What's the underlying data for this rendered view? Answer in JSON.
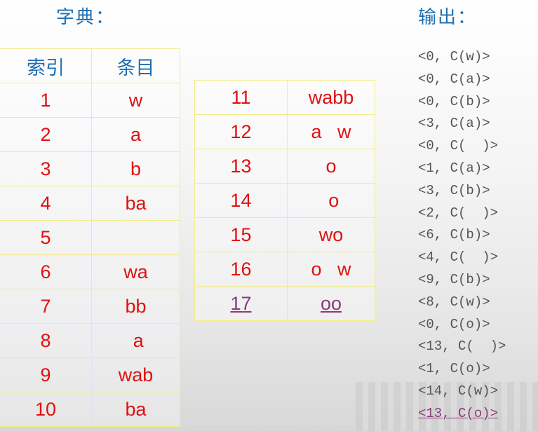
{
  "headings": {
    "dictionary": "字典：",
    "output": "输出："
  },
  "table_headers": {
    "index": "索引",
    "entry": "条目"
  },
  "table1": [
    {
      "index": "1",
      "entry": "w"
    },
    {
      "index": "2",
      "entry": "a"
    },
    {
      "index": "3",
      "entry": "b"
    },
    {
      "index": "4",
      "entry": "ba"
    },
    {
      "index": "5",
      "entry": ""
    },
    {
      "index": "6",
      "entry": "wa"
    },
    {
      "index": "7",
      "entry": "bb"
    },
    {
      "index": "8",
      "entry": " a"
    },
    {
      "index": "9",
      "entry": "wab"
    },
    {
      "index": "10",
      "entry": "ba"
    }
  ],
  "table2": [
    {
      "index": "11",
      "entry": "wabb"
    },
    {
      "index": "12",
      "entry": "a   w"
    },
    {
      "index": "13",
      "entry": "o"
    },
    {
      "index": "14",
      "entry": " o"
    },
    {
      "index": "15",
      "entry": "wo"
    },
    {
      "index": "16",
      "entry": "o   w"
    },
    {
      "index": "17",
      "entry": "oo"
    }
  ],
  "output": [
    "<0, C(w)>",
    "<0, C(a)>",
    "<0, C(b)>",
    "<3, C(a)>",
    "<0, C(  )>",
    "<1, C(a)>",
    "<3, C(b)>",
    "<2, C(  )>",
    "<6, C(b)>",
    "<4, C(  )>",
    "<9, C(b)>",
    "<8, C(w)>",
    "<0, C(o)>",
    "<13, C(  )>",
    "<1, C(o)>",
    "<14, C(w)>",
    "<13, C(o)>"
  ],
  "colors": {
    "heading": "#1f6fb2",
    "cell_text": "#e01010",
    "highlight": "#8b3a7a",
    "border": "#f2ec8c"
  }
}
